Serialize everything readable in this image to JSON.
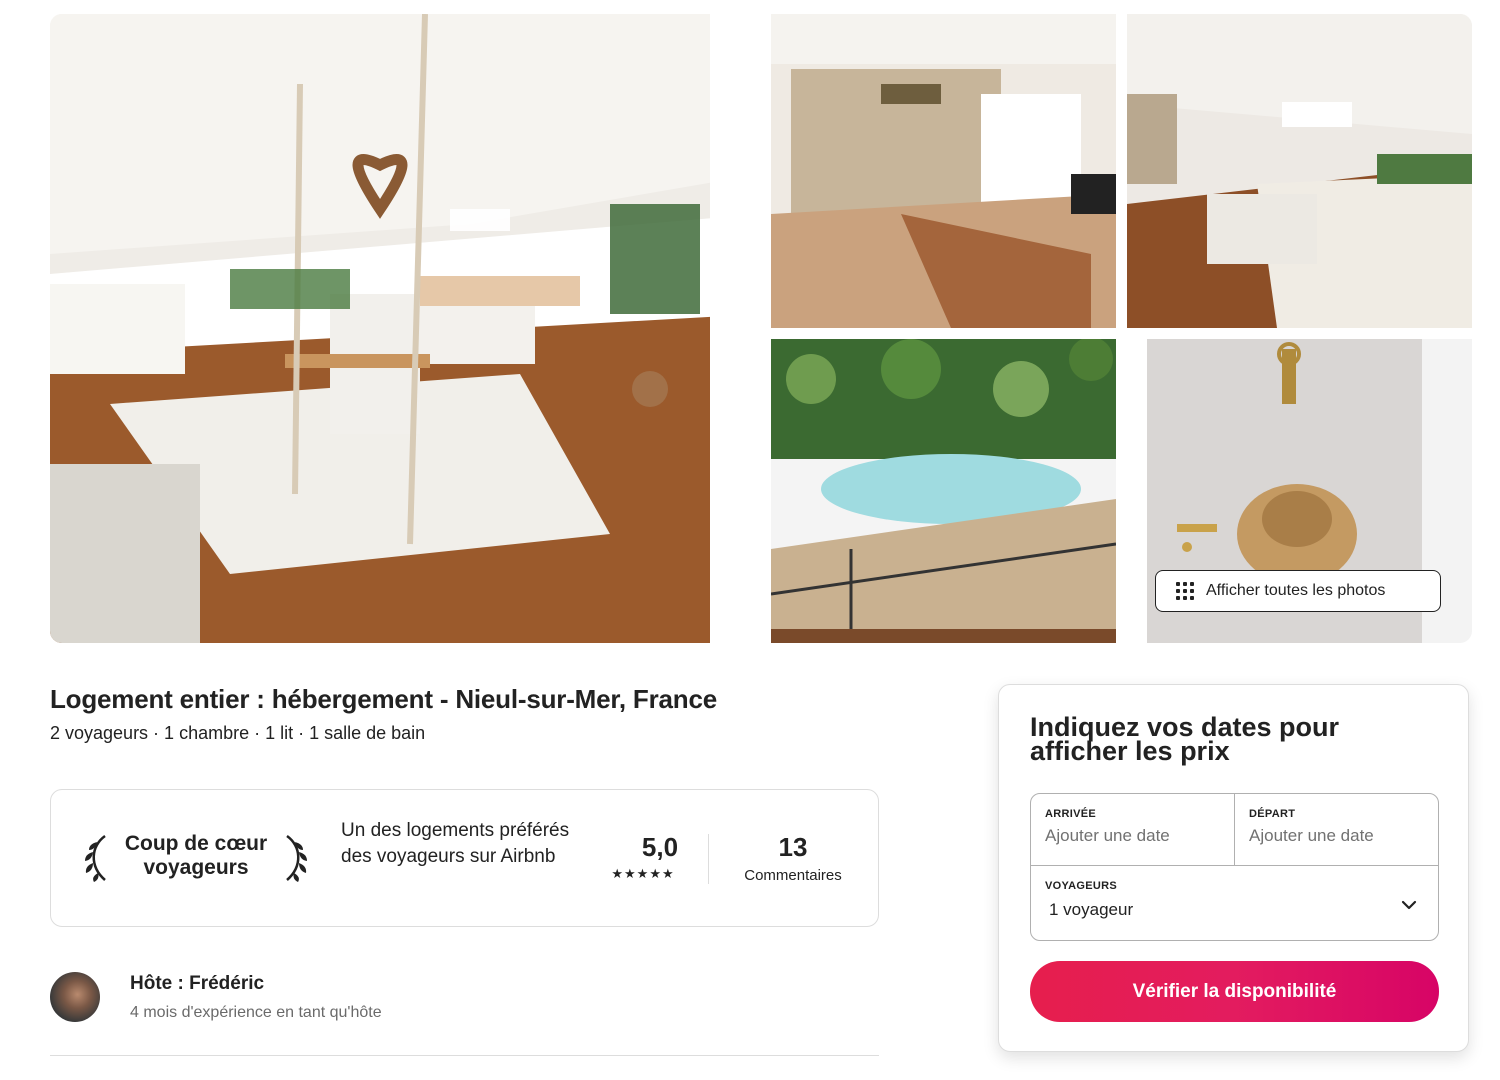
{
  "gallery": {
    "show_all_label": "Afficher toutes les photos"
  },
  "listing": {
    "title": "Logement entier : hébergement - Nieul-sur-Mer, France",
    "summary": "2 voyageurs · 1 chambre · 1 lit · 1 salle de bain"
  },
  "guest_favorite": {
    "label": "Coup de cœur voyageurs",
    "description": "Un des logements préférés des voyageurs sur Airbnb",
    "rating": "5,0",
    "stars": "★★★★★",
    "reviews_count": "13",
    "reviews_label": "Commentaires"
  },
  "host": {
    "name": "Hôte : Frédéric",
    "experience": "4 mois d'expérience en tant qu'hôte"
  },
  "booking": {
    "heading": "Indiquez vos dates pour afficher les prix",
    "checkin_label": "ARRIVÉE",
    "checkin_placeholder": "Ajouter une date",
    "checkout_label": "DÉPART",
    "checkout_placeholder": "Ajouter une date",
    "guests_label": "VOYAGEURS",
    "guests_value": "1 voyageur",
    "cta_label": "Vérifier la disponibilité"
  },
  "colors": {
    "accent": "#e31c5f",
    "text": "#222222",
    "muted": "#717171",
    "border": "#dddddd"
  },
  "icons": [
    "grid-dots-icon",
    "laurel-left-icon",
    "laurel-right-icon",
    "star-icon",
    "chevron-down-icon"
  ]
}
